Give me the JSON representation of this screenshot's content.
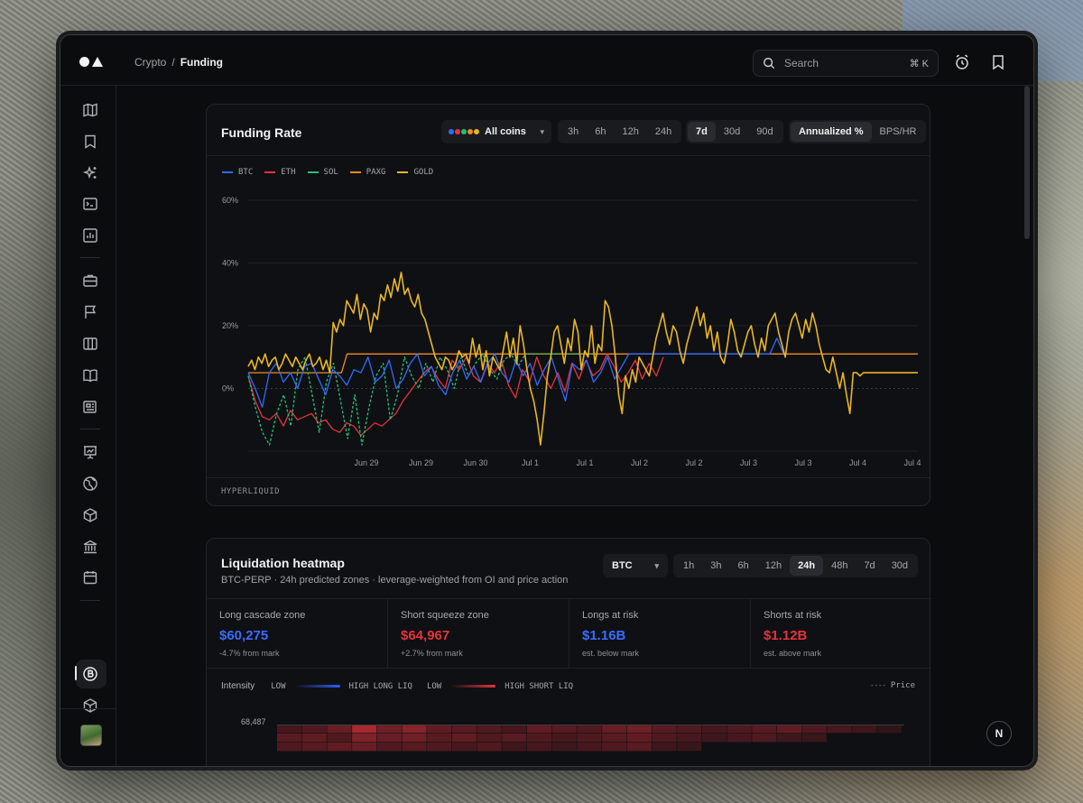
{
  "breadcrumb": {
    "parent": "Crypto",
    "separator": "/",
    "current": "Funding"
  },
  "search": {
    "placeholder": "Search",
    "shortcut": "⌘ K"
  },
  "icons": {
    "sidebar": [
      "map-icon",
      "bookmark-icon",
      "sparkles-icon",
      "terminal-icon",
      "bar-chart-icon",
      "briefcase-icon",
      "flag-icon",
      "columns-icon",
      "book-icon",
      "newspaper-icon",
      "presentation-chart-icon",
      "globe-icon",
      "cube-icon",
      "bank-icon",
      "calendar-icon",
      "bitcoin-icon",
      "box-icon",
      "euro-icon"
    ],
    "top": [
      "alarm-icon",
      "bookmark-icon"
    ]
  },
  "funding": {
    "title": "Funding Rate",
    "coins_label": "All coins",
    "coin_colors": [
      "#2f6bff",
      "#e5333d",
      "#22c07a",
      "#f08b22",
      "#e8b625"
    ],
    "timeframes_short": [
      {
        "label": "3h",
        "active": false
      },
      {
        "label": "6h",
        "active": false
      },
      {
        "label": "12h",
        "active": false
      },
      {
        "label": "24h",
        "active": false
      }
    ],
    "timeframes_long": [
      {
        "label": "7d",
        "active": true
      },
      {
        "label": "30d",
        "active": false
      },
      {
        "label": "90d",
        "active": false
      }
    ],
    "units": [
      {
        "label": "Annualized %",
        "active": true
      },
      {
        "label": "BPS/HR",
        "active": false
      }
    ],
    "source": "HYPERLIQUID"
  },
  "chart_data": {
    "type": "line",
    "y_ticks": [
      "60%",
      "40%",
      "20%",
      "0%"
    ],
    "ylim": [
      -20,
      60
    ],
    "x_ticks": [
      "Jun 29",
      "Jun 29",
      "Jun 30",
      "Jul 1",
      "Jul 1",
      "Jul 2",
      "Jul 2",
      "Jul 3",
      "Jul 3",
      "Jul 4",
      "Jul 4"
    ],
    "grid": true,
    "legend_position": "top-left",
    "series": [
      {
        "name": "BTC",
        "color": "#2f6bff",
        "style": "solid",
        "values": [
          5,
          0,
          -6,
          5,
          8,
          2,
          5,
          0,
          7,
          8,
          3,
          -2,
          6,
          4,
          1,
          6,
          5,
          10,
          2,
          4,
          9,
          0,
          3,
          8,
          11,
          4,
          7,
          1,
          -2,
          5,
          9,
          3,
          7,
          2,
          8,
          11,
          5,
          2,
          9,
          4,
          8,
          1,
          6,
          10,
          3,
          -4,
          8,
          6,
          9,
          2,
          5,
          10,
          3,
          7,
          11,
          11,
          11,
          11,
          11,
          11,
          11,
          11,
          11,
          11,
          11,
          11,
          11,
          11,
          11,
          11,
          11,
          11,
          11,
          11,
          11,
          16,
          11
        ]
      },
      {
        "name": "ETH",
        "color": "#e5333d",
        "style": "solid",
        "values": [
          4,
          -4,
          -9,
          -10,
          -8,
          -12,
          -7,
          -10,
          -9,
          -8,
          -11,
          -10,
          -13,
          -14,
          -11,
          -12,
          -15,
          -13,
          -11,
          -12,
          -10,
          -8,
          -4,
          -1,
          2,
          5,
          7,
          3,
          0,
          9,
          6,
          10,
          4,
          2,
          8,
          5,
          9,
          1,
          -3,
          6,
          2,
          10,
          4,
          0,
          5,
          -1,
          8,
          3,
          9,
          4,
          6,
          11,
          7,
          2,
          5,
          9,
          3,
          8,
          4,
          10
        ]
      },
      {
        "name": "SOL",
        "color": "#22c07a",
        "style": "dashed",
        "values": [
          4,
          -6,
          -14,
          -18,
          -8,
          -2,
          -12,
          6,
          10,
          -2,
          -14,
          2,
          8,
          -4,
          -16,
          -2,
          -18,
          -6,
          4,
          8,
          -10,
          -2,
          10,
          4,
          0,
          8,
          2,
          10,
          6,
          0,
          10,
          4,
          8,
          11,
          6,
          3,
          9,
          11,
          7,
          11,
          11,
          11,
          11,
          11,
          11,
          11,
          11,
          11,
          11,
          11
        ]
      },
      {
        "name": "PAXG",
        "color": "#f08b22",
        "style": "solid",
        "values": [
          5,
          5,
          5,
          5,
          5,
          5,
          5,
          5,
          5,
          5,
          5,
          5,
          5,
          5,
          5,
          5,
          5,
          5,
          11,
          11,
          11,
          11,
          11,
          11,
          11,
          11,
          11,
          11,
          11,
          11,
          11,
          11,
          11,
          11,
          11,
          11,
          11,
          11,
          11,
          11,
          11,
          11,
          11,
          11,
          11,
          11,
          11,
          11,
          11,
          11,
          11,
          11,
          11,
          11,
          11,
          11,
          11,
          11,
          11,
          11,
          11,
          11,
          11,
          11,
          11,
          11,
          11,
          11,
          11,
          11,
          11,
          11,
          11,
          11,
          11,
          11,
          11,
          11,
          11,
          11,
          11,
          11,
          11,
          11,
          11,
          11,
          11,
          11,
          11,
          11,
          11,
          11,
          11,
          11,
          11,
          11,
          11,
          11,
          11,
          11,
          11,
          11,
          11,
          11,
          11,
          11,
          11,
          11,
          11,
          11,
          11,
          11,
          11,
          11,
          11,
          11,
          11,
          11,
          11,
          11,
          11,
          11,
          11
        ]
      },
      {
        "name": "GOLD",
        "color": "#e8b625",
        "style": "solid",
        "values": [
          7,
          9,
          6,
          10,
          8,
          11,
          7,
          9,
          10,
          6,
          8,
          11,
          9,
          7,
          10,
          8,
          6,
          9,
          11,
          7,
          8,
          10,
          6,
          9,
          5,
          21,
          18,
          22,
          20,
          28,
          26,
          24,
          30,
          22,
          27,
          25,
          18,
          24,
          22,
          30,
          28,
          33,
          29,
          35,
          31,
          37,
          30,
          32,
          28,
          26,
          30,
          24,
          22,
          18,
          14,
          10,
          8,
          6,
          10,
          9,
          6,
          8,
          12,
          10,
          11,
          8,
          16,
          10,
          14,
          6,
          12,
          4,
          10,
          8,
          6,
          12,
          18,
          10,
          16,
          8,
          20,
          14,
          6,
          0,
          -4,
          -10,
          -18,
          -8,
          4,
          10,
          18,
          20,
          14,
          8,
          16,
          12,
          22,
          18,
          6,
          12,
          10,
          20,
          8,
          14,
          12,
          28,
          26,
          20,
          10,
          -2,
          -8,
          4,
          0,
          6,
          2,
          10,
          8,
          6,
          4,
          10,
          16,
          20,
          24,
          18,
          14,
          20,
          18,
          12,
          8,
          14,
          18,
          22,
          26,
          20,
          24,
          16,
          20,
          12,
          18,
          10,
          8,
          14,
          22,
          18,
          12,
          10,
          14,
          18,
          20,
          14,
          10,
          16,
          12,
          20,
          22,
          24,
          18,
          14,
          10,
          18,
          22,
          24,
          20,
          16,
          22,
          18,
          24,
          20,
          14,
          10,
          6,
          5,
          10,
          5,
          0,
          5,
          -2,
          -8,
          5,
          5,
          4,
          5,
          5,
          5,
          5,
          5,
          5,
          5,
          5,
          5,
          5,
          5,
          5,
          5,
          5,
          5,
          5,
          5
        ]
      }
    ]
  },
  "heatmap": {
    "title": "Liquidation heatmap",
    "subtitle": "BTC-PERP · 24h predicted zones · leverage-weighted from OI and price action",
    "pair": "BTC",
    "timeframes": [
      {
        "label": "1h",
        "active": false
      },
      {
        "label": "3h",
        "active": false
      },
      {
        "label": "6h",
        "active": false
      },
      {
        "label": "12h",
        "active": false
      },
      {
        "label": "24h",
        "active": true
      },
      {
        "label": "48h",
        "active": false
      },
      {
        "label": "7d",
        "active": false
      },
      {
        "label": "30d",
        "active": false
      }
    ],
    "stats": [
      {
        "label": "Long cascade zone",
        "value": "$60,275",
        "sub": "-4.7% from mark",
        "color": "#3b6cff"
      },
      {
        "label": "Short squeeze zone",
        "value": "$64,967",
        "sub": "+2.7% from mark",
        "color": "#e5333d"
      },
      {
        "label": "Longs at risk",
        "value": "$1.16B",
        "sub": "est. below mark",
        "color": "#3b6cff"
      },
      {
        "label": "Shorts at risk",
        "value": "$1.12B",
        "sub": "est. above mark",
        "color": "#e5333d"
      }
    ],
    "intensity": {
      "title": "Intensity",
      "low1": "LOW",
      "high_long": "HIGH LONG LIQ",
      "low2": "LOW",
      "high_short": "HIGH SHORT LIQ",
      "price_label": "Price"
    },
    "price_tick": "68,487",
    "long_color": "#2f5bff",
    "short_color": "#e5333d"
  },
  "badge": {
    "label": "N"
  }
}
